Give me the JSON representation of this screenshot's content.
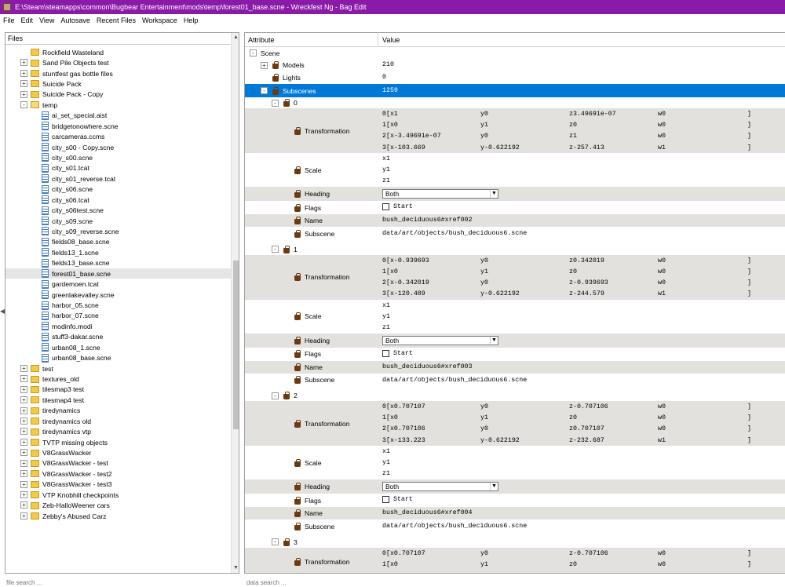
{
  "window": {
    "title": "E:\\Steam\\steamapps\\common\\Bugbear Entertainment\\mods\\temp\\forest01_base.scne - Wreckfest Ng - Bag Edit"
  },
  "menu": [
    "File",
    "Edit",
    "View",
    "Autosave",
    "Recent Files",
    "Workspace",
    "Help"
  ],
  "files": {
    "header": "Files",
    "search_placeholder": "file search ...",
    "items": [
      {
        "label": "Rockfield Wasteland",
        "type": "folder",
        "depth": 1,
        "expander": ""
      },
      {
        "label": "Sand Pile Objects test",
        "type": "folder",
        "depth": 1,
        "expander": "+"
      },
      {
        "label": "stuntfest gas bottle files",
        "type": "folder",
        "depth": 1,
        "expander": "+"
      },
      {
        "label": "Suicide Pack",
        "type": "folder",
        "depth": 1,
        "expander": "+"
      },
      {
        "label": "Suicide Pack - Copy",
        "type": "folder",
        "depth": 1,
        "expander": "+"
      },
      {
        "label": "temp",
        "type": "folder-open",
        "depth": 1,
        "expander": "-"
      },
      {
        "label": "ai_set_special.aist",
        "type": "file",
        "depth": 2,
        "expander": ""
      },
      {
        "label": "bridgetonowhere.scne",
        "type": "file",
        "depth": 2,
        "expander": ""
      },
      {
        "label": "carcameras.ccms",
        "type": "file",
        "depth": 2,
        "expander": ""
      },
      {
        "label": "city_s00 - Copy.scne",
        "type": "file",
        "depth": 2,
        "expander": ""
      },
      {
        "label": "city_s00.scne",
        "type": "file",
        "depth": 2,
        "expander": ""
      },
      {
        "label": "city_s01.tcat",
        "type": "file",
        "depth": 2,
        "expander": ""
      },
      {
        "label": "city_s01_reverse.tcat",
        "type": "file",
        "depth": 2,
        "expander": ""
      },
      {
        "label": "city_s06.scne",
        "type": "file",
        "depth": 2,
        "expander": ""
      },
      {
        "label": "city_s06.tcat",
        "type": "file",
        "depth": 2,
        "expander": ""
      },
      {
        "label": "city_s06test.scne",
        "type": "file",
        "depth": 2,
        "expander": ""
      },
      {
        "label": "city_s09.scne",
        "type": "file",
        "depth": 2,
        "expander": ""
      },
      {
        "label": "city_s09_reverse.scne",
        "type": "file",
        "depth": 2,
        "expander": ""
      },
      {
        "label": "fields08_base.scne",
        "type": "file",
        "depth": 2,
        "expander": ""
      },
      {
        "label": "fields13_1.scne",
        "type": "file",
        "depth": 2,
        "expander": ""
      },
      {
        "label": "fields13_base.scne",
        "type": "file",
        "depth": 2,
        "expander": ""
      },
      {
        "label": "forest01_base.scne",
        "type": "file",
        "depth": 2,
        "expander": "",
        "selected": true
      },
      {
        "label": "gardemoen.tcat",
        "type": "file",
        "depth": 2,
        "expander": ""
      },
      {
        "label": "greenlakevalley.scne",
        "type": "file",
        "depth": 2,
        "expander": ""
      },
      {
        "label": "harbor_05.scne",
        "type": "file",
        "depth": 2,
        "expander": ""
      },
      {
        "label": "harbor_07.scne",
        "type": "file",
        "depth": 2,
        "expander": ""
      },
      {
        "label": "modinfo.modi",
        "type": "file",
        "depth": 2,
        "expander": ""
      },
      {
        "label": "stuff3-dakar.scne",
        "type": "file",
        "depth": 2,
        "expander": ""
      },
      {
        "label": "urban08_1.scne",
        "type": "file",
        "depth": 2,
        "expander": ""
      },
      {
        "label": "urban08_base.scne",
        "type": "file",
        "depth": 2,
        "expander": ""
      },
      {
        "label": "test",
        "type": "folder",
        "depth": 1,
        "expander": "+"
      },
      {
        "label": "textures_old",
        "type": "folder",
        "depth": 1,
        "expander": "+"
      },
      {
        "label": "tilesmap3 test",
        "type": "folder",
        "depth": 1,
        "expander": "+"
      },
      {
        "label": "tilesmap4 test",
        "type": "folder",
        "depth": 1,
        "expander": "+"
      },
      {
        "label": "tiredynamics",
        "type": "folder",
        "depth": 1,
        "expander": "+"
      },
      {
        "label": "tiredynamics old",
        "type": "folder",
        "depth": 1,
        "expander": "+"
      },
      {
        "label": "tiredynamics vtp",
        "type": "folder",
        "depth": 1,
        "expander": "+"
      },
      {
        "label": "TVTP missing objects",
        "type": "folder",
        "depth": 1,
        "expander": "+"
      },
      {
        "label": "V8GrassWacker",
        "type": "folder",
        "depth": 1,
        "expander": "+"
      },
      {
        "label": "V8GrassWacker - test",
        "type": "folder",
        "depth": 1,
        "expander": "+"
      },
      {
        "label": "V8GrassWacker - test2",
        "type": "folder",
        "depth": 1,
        "expander": "+"
      },
      {
        "label": "V8GrassWacker - test3",
        "type": "folder",
        "depth": 1,
        "expander": "+"
      },
      {
        "label": "VTP Knobhill checkpoints",
        "type": "folder",
        "depth": 1,
        "expander": "+"
      },
      {
        "label": "Zeb-HalloWeener cars",
        "type": "folder",
        "depth": 1,
        "expander": "+"
      },
      {
        "label": "Zebby's Abused Carz",
        "type": "folder",
        "depth": 1,
        "expander": "+"
      }
    ]
  },
  "attributes": {
    "header_attribute": "Attribute",
    "header_value": "Value",
    "search_placeholder": "data search ...",
    "scene_label": "Scene",
    "models": {
      "label": "Models",
      "value": "210"
    },
    "lights": {
      "label": "Lights",
      "value": "0"
    },
    "subscenes": {
      "label": "Subscenes",
      "value": "1259"
    },
    "labels": {
      "transformation": "Transformation",
      "scale": "Scale",
      "heading": "Heading",
      "flags": "Flags",
      "name": "Name",
      "subscene": "Subscene"
    },
    "entries": [
      {
        "index": "0",
        "matrix": [
          [
            "0[x1",
            "y0",
            "z3.49691e-07",
            "w0",
            "]"
          ],
          [
            "1[x0",
            "y1",
            "z0",
            "w0",
            "]"
          ],
          [
            "2[x-3.49691e-07",
            "y0",
            "z1",
            "w0",
            "]"
          ],
          [
            "3[x-103.669",
            "y-0.622192",
            "z-257.413",
            "w1",
            "]"
          ]
        ],
        "scale": [
          "x1",
          "y1",
          "z1"
        ],
        "heading": "Both",
        "flag": "Start",
        "name": "bush_deciduous6#xref002",
        "subscene": "data/art/objects/bush_deciduous6.scne"
      },
      {
        "index": "1",
        "matrix": [
          [
            "0[x-0.939693",
            "y0",
            "z0.342019",
            "w0",
            "]"
          ],
          [
            "1[x0",
            "y1",
            "z0",
            "w0",
            "]"
          ],
          [
            "2[x-0.342019",
            "y0",
            "z-0.939693",
            "w0",
            "]"
          ],
          [
            "3[x-120.489",
            "y-0.622192",
            "z-244.579",
            "w1",
            "]"
          ]
        ],
        "scale": [
          "x1",
          "y1",
          "z1"
        ],
        "heading": "Both",
        "flag": "Start",
        "name": "bush_deciduous6#xref003",
        "subscene": "data/art/objects/bush_deciduous6.scne"
      },
      {
        "index": "2",
        "matrix": [
          [
            "0[x0.707107",
            "y0",
            "z-0.707106",
            "w0",
            "]"
          ],
          [
            "1[x0",
            "y1",
            "z0",
            "w0",
            "]"
          ],
          [
            "2[x0.707106",
            "y0",
            "z0.707107",
            "w0",
            "]"
          ],
          [
            "3[x-133.223",
            "y-0.622192",
            "z-232.687",
            "w1",
            "]"
          ]
        ],
        "scale": [
          "x1",
          "y1",
          "z1"
        ],
        "heading": "Both",
        "flag": "Start",
        "name": "bush_deciduous6#xref004",
        "subscene": "data/art/objects/bush_deciduous6.scne"
      },
      {
        "index": "3",
        "matrix": [
          [
            "0[x0.707107",
            "y0",
            "z-0.707106",
            "w0",
            "]"
          ],
          [
            "1[x0",
            "y1",
            "z0",
            "w0",
            "]"
          ]
        ]
      }
    ]
  },
  "colors": {
    "titlebar": "#8a1aa8",
    "selection": "#0078d7",
    "shaded_row": "#e3e1de"
  }
}
